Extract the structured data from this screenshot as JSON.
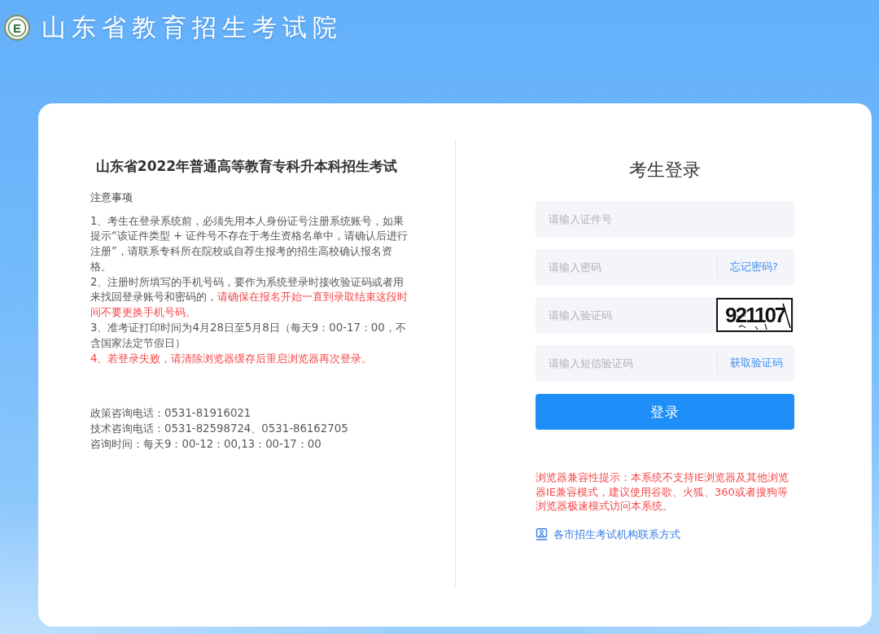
{
  "header": {
    "logo_letter": "E",
    "title": "山东省教育招生考试院"
  },
  "notice": {
    "title": "山东省2022年普通高等教育专科升本科招生考试",
    "heading": "注意事项",
    "items": [
      {
        "parts": [
          {
            "text": "1、考生在登录系统前，必须先用本人身份证号注册系统账号，如果提示“该证件类型 + 证件号不存在于考生资格名单中，请确认后进行注册”，请联系专科所在院校或自荐生报考的招生高校确认报名资格。",
            "warning": false
          }
        ]
      },
      {
        "parts": [
          {
            "text": "2、注册时所填写的手机号码，要作为系统登录时接收验证码或者用来找回登录账号和密码的，",
            "warning": false
          },
          {
            "text": "请确保在报名开始一直到录取结束这段时间不要更换手机号码。",
            "warning": true
          }
        ]
      },
      {
        "parts": [
          {
            "text": "3、准考证打印时间为4月28日至5月8日（每天9：00-17：00，不含国家法定节假日）",
            "warning": false
          }
        ]
      },
      {
        "parts": [
          {
            "text": "4、若登录失败，请清除浏览器缓存后重启浏览器再次登录。",
            "warning": true
          }
        ]
      }
    ],
    "contacts": [
      "政策咨询电话：0531-81916021",
      "技术咨询电话：0531-82598724、0531-86162705",
      "咨询时间：每天9：00-12：00,13：00-17：00"
    ]
  },
  "login": {
    "title": "考生登录",
    "fields": [
      {
        "kind": "text",
        "placeholder": "请输入证件号"
      },
      {
        "kind": "link",
        "placeholder": "请输入密码",
        "action": "忘记密码?"
      },
      {
        "kind": "captcha",
        "placeholder": "请输入验证码",
        "captcha": "921107"
      },
      {
        "kind": "link",
        "placeholder": "请输入短信验证码",
        "action": "获取验证码"
      }
    ],
    "submit": "登录",
    "compat_notice": "浏览器兼容性提示：本系统不支持IE浏览器及其他浏览器IE兼容模式，建议使用谷歌、火狐、360或者搜狗等浏览器极速模式访问本系统。",
    "contact_link": "各市招生考试机构联系方式"
  }
}
